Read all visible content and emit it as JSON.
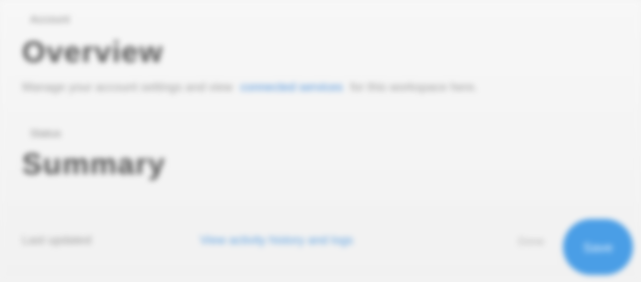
{
  "section_a": {
    "label": "Account",
    "heading": "Overview",
    "description_prefix": "Manage your account settings and view",
    "description_link": "connected services",
    "description_suffix": "for this workspace here."
  },
  "section_b": {
    "label": "Status",
    "heading": "Summary"
  },
  "footer": {
    "left_text": "Last updated",
    "link_text": "View activity history and logs",
    "badge_text": "Done"
  },
  "action_button": {
    "label": "Save"
  },
  "colors": {
    "accent": "#4a9ee6",
    "link": "#4a90d9",
    "background": "#f3f3f3"
  }
}
